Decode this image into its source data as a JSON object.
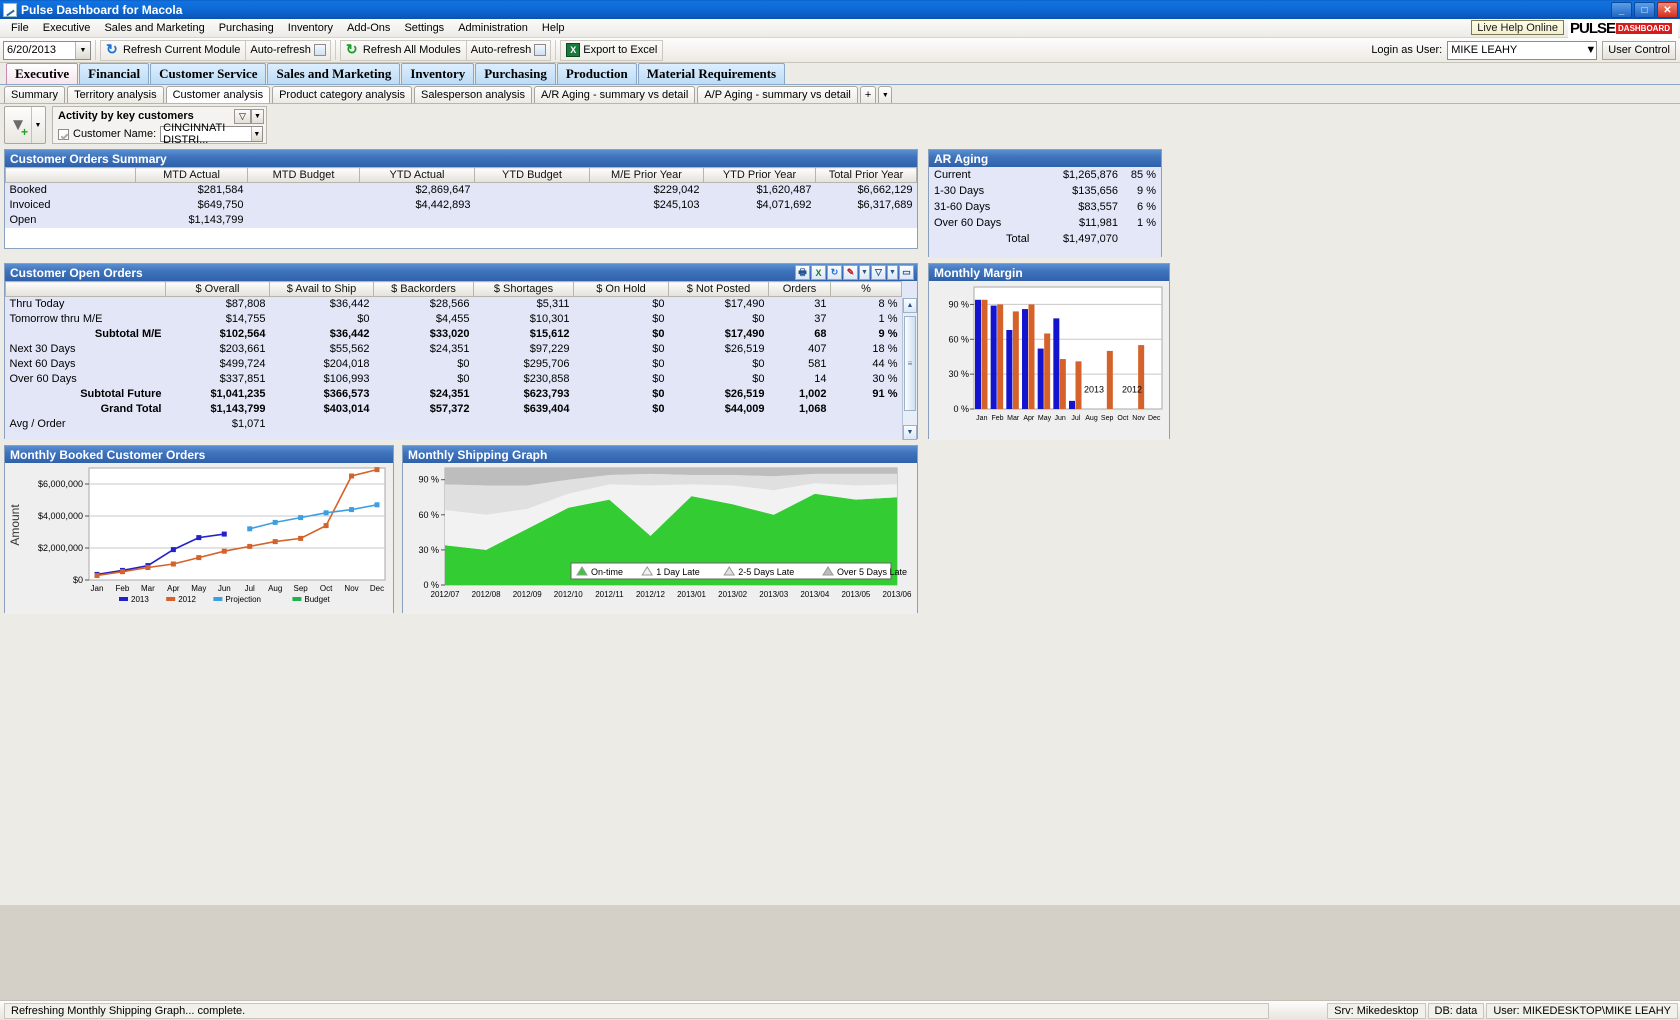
{
  "window": {
    "title": "Pulse Dashboard for Macola",
    "app_icon": "chart-icon",
    "minimize": "_",
    "maximize": "□",
    "close": "✕"
  },
  "menu": {
    "items": [
      "File",
      "Executive",
      "Sales and Marketing",
      "Purchasing",
      "Inventory",
      "Add-Ons",
      "Settings",
      "Administration",
      "Help"
    ],
    "live_help": "Live Help Online",
    "logo_text": "PULSE",
    "logo_badge": "DASHBOARD"
  },
  "toolbar": {
    "date": "6/20/2013",
    "refresh_current": "Refresh Current Module",
    "auto_refresh_1": "Auto-refresh",
    "refresh_all": "Refresh All Modules",
    "auto_refresh_2": "Auto-refresh",
    "export_excel": "Export to Excel",
    "excel_glyph": "X",
    "login_label": "Login as User:",
    "login_user": "MIKE LEAHY",
    "user_control": "User Control"
  },
  "module_tabs": [
    {
      "label": "Executive",
      "active": true
    },
    {
      "label": "Financial",
      "active": false
    },
    {
      "label": "Customer Service",
      "active": false
    },
    {
      "label": "Sales and Marketing",
      "active": false
    },
    {
      "label": "Inventory",
      "active": false
    },
    {
      "label": "Purchasing",
      "active": false
    },
    {
      "label": "Production",
      "active": false
    },
    {
      "label": "Material Requirements",
      "active": false
    }
  ],
  "sub_tabs": [
    {
      "label": "Summary",
      "active": false
    },
    {
      "label": "Territory analysis",
      "active": false
    },
    {
      "label": "Customer analysis",
      "active": true
    },
    {
      "label": "Product category analysis",
      "active": false
    },
    {
      "label": "Salesperson analysis",
      "active": false
    },
    {
      "label": "A/R Aging - summary vs detail",
      "active": false
    },
    {
      "label": "A/P Aging - summary vs detail",
      "active": false
    },
    {
      "label": "+",
      "active": false
    }
  ],
  "filter": {
    "title": "Activity by key customers",
    "filter_glyph": "▽",
    "row_label": "Customer Name:",
    "row_value": "CINCINNATI DISTRI..."
  },
  "orders_summary": {
    "title": "Customer Orders Summary",
    "columns": [
      "",
      "MTD Actual",
      "MTD Budget",
      "YTD Actual",
      "YTD Budget",
      "M/E Prior Year",
      "YTD Prior Year",
      "Total Prior Year"
    ],
    "rows": [
      {
        "label": "Booked",
        "values": [
          "$281,584",
          "",
          "$2,869,647",
          "",
          "$229,042",
          "$1,620,487",
          "$6,662,129"
        ]
      },
      {
        "label": "Invoiced",
        "values": [
          "$649,750",
          "",
          "$4,442,893",
          "",
          "$245,103",
          "$4,071,692",
          "$6,317,689"
        ]
      },
      {
        "label": "Open",
        "values": [
          "$1,143,799",
          "",
          "",
          "",
          "",
          "",
          ""
        ]
      }
    ]
  },
  "ar_aging": {
    "title": "AR Aging",
    "rows": [
      {
        "label": "Current",
        "amount": "$1,265,876",
        "pct": "85 %"
      },
      {
        "label": "1-30 Days",
        "amount": "$135,656",
        "pct": "9 %"
      },
      {
        "label": "31-60 Days",
        "amount": "$83,557",
        "pct": "6 %"
      },
      {
        "label": "Over 60 Days",
        "amount": "$11,981",
        "pct": "1 %"
      },
      {
        "label": "Total",
        "amount": "$1,497,070",
        "pct": ""
      }
    ]
  },
  "open_orders": {
    "title": "Customer Open Orders",
    "tools": [
      "print-icon",
      "excel-icon",
      "refresh-icon",
      "wrench-icon",
      "chevron-down-icon",
      "funnel-icon",
      "chevron-down-icon-2",
      "restore-icon"
    ],
    "columns": [
      "",
      "$ Overall",
      "$ Avail to Ship",
      "$ Backorders",
      "$ Shortages",
      "$ On Hold",
      "$ Not Posted",
      "Orders",
      "%"
    ],
    "rows": [
      {
        "label": "Thru Today",
        "bold": false,
        "values": [
          "$87,808",
          "$36,442",
          "$28,566",
          "$5,311",
          "$0",
          "$17,490",
          "31",
          "8 %"
        ]
      },
      {
        "label": "Tomorrow thru M/E",
        "bold": false,
        "values": [
          "$14,755",
          "$0",
          "$4,455",
          "$10,301",
          "$0",
          "$0",
          "37",
          "1 %"
        ]
      },
      {
        "label": "Subtotal M/E",
        "bold": true,
        "values": [
          "$102,564",
          "$36,442",
          "$33,020",
          "$15,612",
          "$0",
          "$17,490",
          "68",
          "9 %"
        ]
      },
      {
        "label": "Next 30 Days",
        "bold": false,
        "values": [
          "$203,661",
          "$55,562",
          "$24,351",
          "$97,229",
          "$0",
          "$26,519",
          "407",
          "18 %"
        ]
      },
      {
        "label": "Next 60 Days",
        "bold": false,
        "values": [
          "$499,724",
          "$204,018",
          "$0",
          "$295,706",
          "$0",
          "$0",
          "581",
          "44 %"
        ]
      },
      {
        "label": "Over 60 Days",
        "bold": false,
        "values": [
          "$337,851",
          "$106,993",
          "$0",
          "$230,858",
          "$0",
          "$0",
          "14",
          "30 %"
        ]
      },
      {
        "label": "Subtotal Future",
        "bold": true,
        "values": [
          "$1,041,235",
          "$366,573",
          "$24,351",
          "$623,793",
          "$0",
          "$26,519",
          "1,002",
          "91 %"
        ]
      },
      {
        "label": "Grand Total",
        "bold": true,
        "values": [
          "$1,143,799",
          "$403,014",
          "$57,372",
          "$639,404",
          "$0",
          "$44,009",
          "1,068",
          ""
        ]
      },
      {
        "label": "Avg / Order",
        "bold": false,
        "values": [
          "$1,071",
          "",
          "",
          "",
          "",
          "",
          "",
          ""
        ]
      }
    ]
  },
  "monthly_margin": {
    "title": "Monthly Margin"
  },
  "booked_orders": {
    "title": "Monthly Booked Customer Orders"
  },
  "shipping_graph": {
    "title": "Monthly Shipping Graph"
  },
  "statusbar": {
    "message": "Refreshing Monthly Shipping Graph... complete.",
    "server": "Srv: Mikedesktop",
    "db": "DB: data",
    "user": "User: MIKEDESKTOP\\MIKE LEAHY"
  },
  "chart_data": [
    {
      "id": "monthly_margin",
      "type": "bar",
      "title": "Monthly Margin",
      "categories": [
        "Jan",
        "Feb",
        "Mar",
        "Apr",
        "May",
        "Jun",
        "Jul",
        "Aug",
        "Sep",
        "Oct",
        "Nov",
        "Dec"
      ],
      "series": [
        {
          "name": "2013",
          "color": "#1414cf",
          "values": [
            94,
            89,
            68,
            86,
            52,
            78,
            7,
            null,
            null,
            null,
            null,
            null
          ]
        },
        {
          "name": "2012",
          "color": "#d4622a",
          "values": [
            94,
            90,
            84,
            90,
            65,
            43,
            41,
            null,
            50,
            null,
            55,
            null
          ]
        }
      ],
      "ylabel": "",
      "ytick_labels": [
        "0 %",
        "30 %",
        "60 %",
        "90 %"
      ],
      "ytick_values": [
        0,
        30,
        60,
        90
      ],
      "ylim": [
        0,
        105
      ],
      "grid": true,
      "legend_position": "inline-on-plot",
      "legend_labels": [
        "2013",
        "2012"
      ]
    },
    {
      "id": "booked_orders",
      "type": "line",
      "title": "Monthly Booked Customer Orders",
      "ylabel": "Amount",
      "categories": [
        "Jan",
        "Feb",
        "Mar",
        "Apr",
        "May",
        "Jun",
        "Jul",
        "Aug",
        "Sep",
        "Oct",
        "Nov",
        "Dec"
      ],
      "ytick_labels": [
        "$0",
        "$2,000,000",
        "$4,000,000",
        "$6,000,000"
      ],
      "ytick_values": [
        0,
        2000000,
        4000000,
        6000000
      ],
      "ylim": [
        0,
        7000000
      ],
      "grid": true,
      "legend_position": "bottom",
      "series": [
        {
          "name": "2013",
          "color": "#2222c8",
          "values": [
            350000,
            600000,
            900000,
            1900000,
            2650000,
            2870000,
            null,
            null,
            null,
            null,
            null,
            null
          ]
        },
        {
          "name": "2012",
          "color": "#d4622a",
          "values": [
            280000,
            520000,
            780000,
            1000000,
            1400000,
            1800000,
            2100000,
            2400000,
            2600000,
            3400000,
            6500000,
            6900000
          ]
        },
        {
          "name": "Projection",
          "color": "#3d9fe0",
          "values": [
            null,
            null,
            null,
            null,
            null,
            null,
            3200000,
            3600000,
            3900000,
            4200000,
            4400000,
            4700000
          ]
        },
        {
          "name": "Budget",
          "color": "#22b14c",
          "values": [
            null,
            null,
            null,
            null,
            null,
            null,
            null,
            null,
            null,
            null,
            null,
            null
          ]
        }
      ],
      "legend_labels": [
        "2013",
        "2012",
        "Projection",
        "Budget"
      ]
    },
    {
      "id": "shipping_graph",
      "type": "area",
      "title": "Monthly Shipping Graph",
      "categories": [
        "2012/07",
        "2012/08",
        "2012/09",
        "2012/10",
        "2012/11",
        "2012/12",
        "2013/01",
        "2013/02",
        "2013/03",
        "2013/04",
        "2013/05",
        "2013/06"
      ],
      "ytick_labels": [
        "0 %",
        "30 %",
        "60 %",
        "90 %"
      ],
      "ytick_values": [
        0,
        30,
        60,
        90
      ],
      "ylim": [
        0,
        100
      ],
      "grid": false,
      "stacked": true,
      "legend_position": "bottom-inside",
      "series": [
        {
          "name": "On-time",
          "color": "#33cc33",
          "values": [
            34,
            30,
            48,
            66,
            73,
            42,
            76,
            69,
            60,
            78,
            73,
            75
          ]
        },
        {
          "name": "1 Day Late",
          "color": "#f2f2f2",
          "values": [
            30,
            30,
            17,
            12,
            13,
            43,
            10,
            16,
            21,
            9,
            12,
            11
          ]
        },
        {
          "name": "2-5 Days Late",
          "color": "#e0e0e0",
          "values": [
            22,
            25,
            20,
            12,
            8,
            10,
            8,
            9,
            12,
            8,
            10,
            9
          ]
        },
        {
          "name": "Over 5 Days Late",
          "color": "#bdbdbd",
          "values": [
            14,
            15,
            15,
            10,
            6,
            5,
            6,
            6,
            7,
            5,
            5,
            5
          ]
        }
      ],
      "legend_labels": [
        "On-time",
        "1 Day Late",
        "2-5 Days Late",
        "Over 5 Days Late"
      ]
    }
  ]
}
